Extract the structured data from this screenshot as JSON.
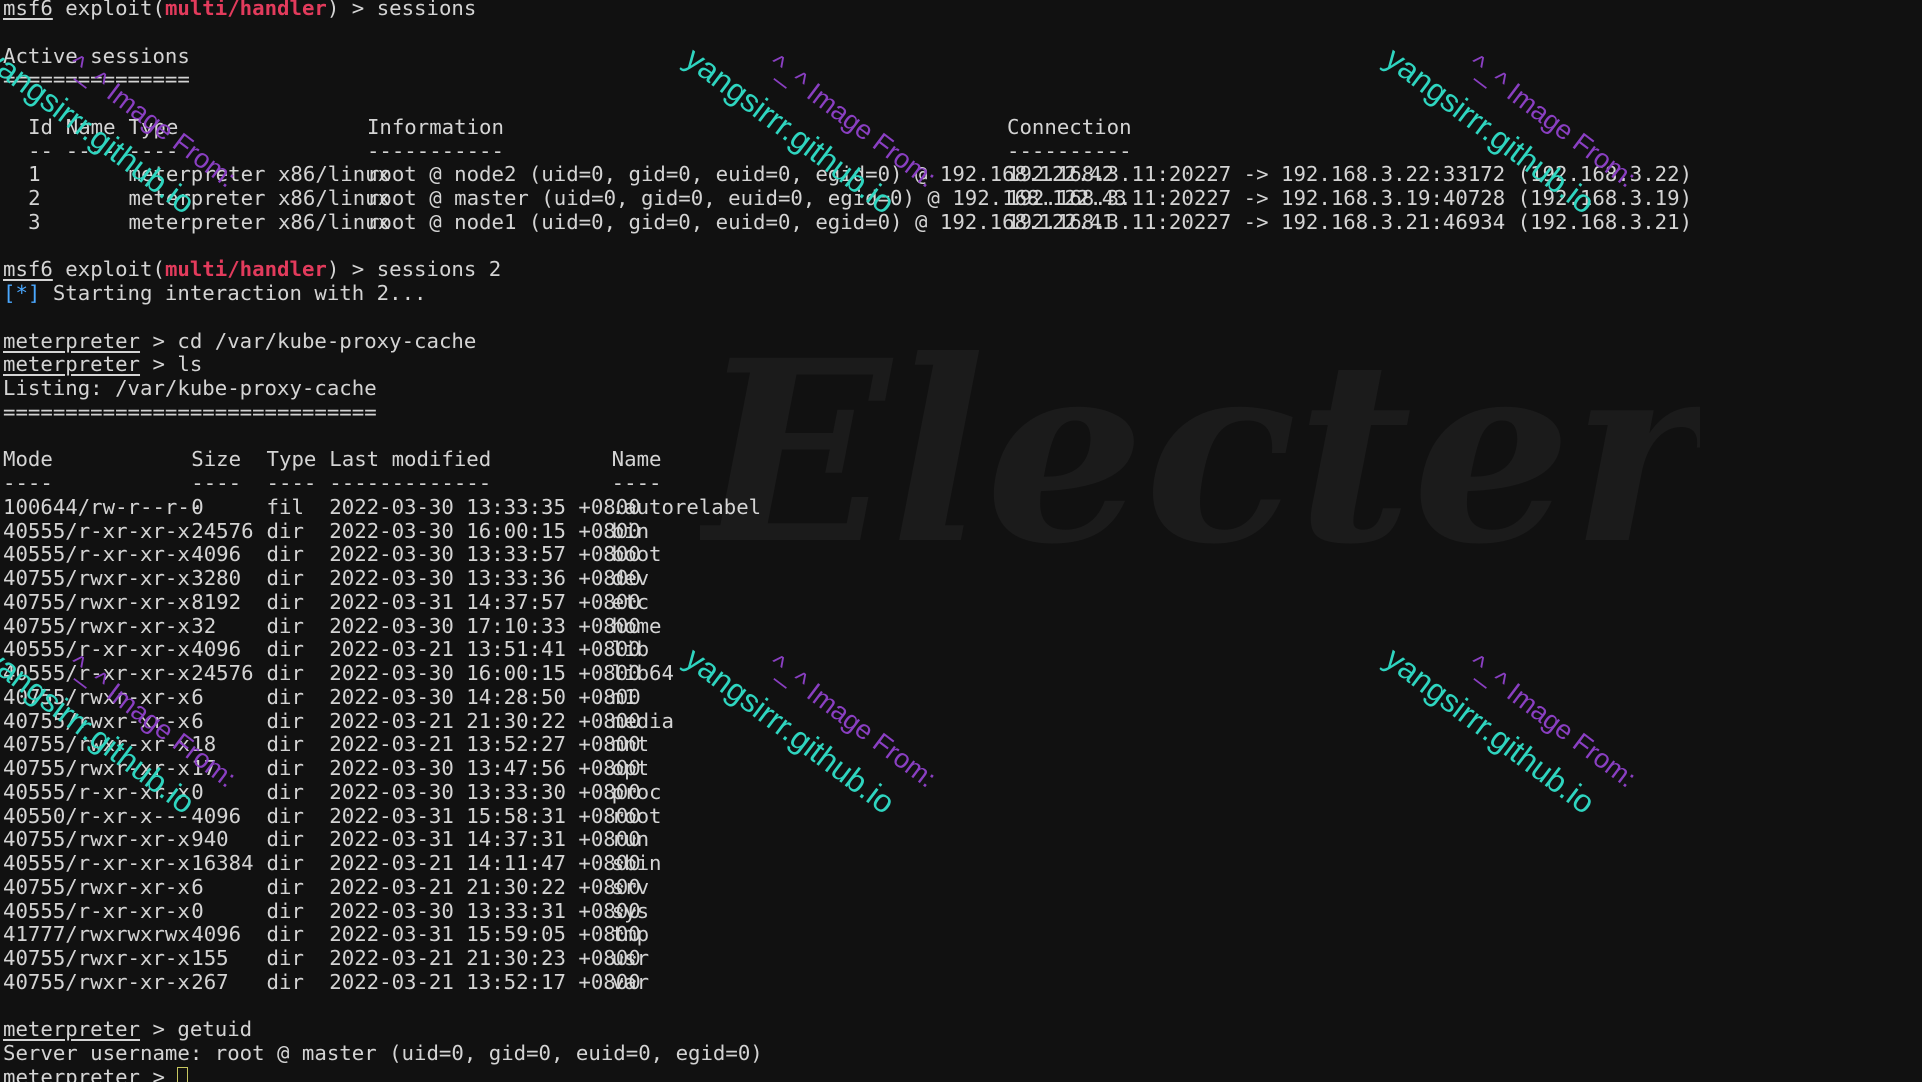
{
  "prompt_msf": "msf6",
  "prompt_exploit_prefix": " exploit(",
  "prompt_module": "multi/handler",
  "prompt_suffix": ") > ",
  "meterpreter_prompt": "meterpreter",
  "prompt_arrow": " > ",
  "cmd_sessions": "sessions",
  "sessions_title": "Active sessions",
  "sessions_title_rule": "===============",
  "sessions_headers": {
    "id": "Id",
    "name": "Name",
    "type": "Type",
    "information": "Information",
    "connection": "Connection"
  },
  "sessions_dashes": {
    "id": "--",
    "name": "----",
    "type": "----",
    "information": "-----------",
    "connection": "----------"
  },
  "sessions_rows": [
    {
      "id": "1",
      "type": "meterpreter x86/linux",
      "information": "root @ node2 (uid=0, gid=0, euid=0, egid=0) @ 192.168.122.42",
      "connection": "192.168.3.11:20227 -> 192.168.3.22:33172 (192.168.3.22)"
    },
    {
      "id": "2",
      "type": "meterpreter x86/linux",
      "information": "root @ master (uid=0, gid=0, euid=0, egid=0) @ 192.168.122.43",
      "connection": "192.168.3.11:20227 -> 192.168.3.19:40728 (192.168.3.19)"
    },
    {
      "id": "3",
      "type": "meterpreter x86/linux",
      "information": "root @ node1 (uid=0, gid=0, euid=0, egid=0) @ 192.168.122.41",
      "connection": "192.168.3.11:20227 -> 192.168.3.21:46934 (192.168.3.21)"
    }
  ],
  "cmd_sessions2": "sessions 2",
  "status_marker": "[*]",
  "status_text": " Starting interaction with 2...",
  "cmd_cd": "cd /var/kube-proxy-cache",
  "cmd_ls": "ls",
  "listing_title": "Listing: /var/kube-proxy-cache",
  "listing_rule": "==============================",
  "listing_headers": {
    "mode": "Mode",
    "size": "Size",
    "type": "Type",
    "modified": "Last modified",
    "name": "Name"
  },
  "listing_dashes": {
    "mode": "----",
    "size": "----",
    "type": "----",
    "modified": "-------------",
    "name": "----"
  },
  "files": [
    {
      "mode": "100644/rw-r--r--",
      "size": "0",
      "type": "fil",
      "modified": "2022-03-30 13:33:35 +0800",
      "name": ".autorelabel"
    },
    {
      "mode": "40555/r-xr-xr-x",
      "size": "24576",
      "type": "dir",
      "modified": "2022-03-30 16:00:15 +0800",
      "name": "bin"
    },
    {
      "mode": "40555/r-xr-xr-x",
      "size": "4096",
      "type": "dir",
      "modified": "2022-03-30 13:33:57 +0800",
      "name": "boot"
    },
    {
      "mode": "40755/rwxr-xr-x",
      "size": "3280",
      "type": "dir",
      "modified": "2022-03-30 13:33:36 +0800",
      "name": "dev"
    },
    {
      "mode": "40755/rwxr-xr-x",
      "size": "8192",
      "type": "dir",
      "modified": "2022-03-31 14:37:57 +0800",
      "name": "etc"
    },
    {
      "mode": "40755/rwxr-xr-x",
      "size": "32",
      "type": "dir",
      "modified": "2022-03-30 17:10:33 +0800",
      "name": "home"
    },
    {
      "mode": "40555/r-xr-xr-x",
      "size": "4096",
      "type": "dir",
      "modified": "2022-03-21 13:51:41 +0800",
      "name": "lib"
    },
    {
      "mode": "40555/r-xr-xr-x",
      "size": "24576",
      "type": "dir",
      "modified": "2022-03-30 16:00:15 +0800",
      "name": "lib64"
    },
    {
      "mode": "40755/rwxr-xr-x",
      "size": "6",
      "type": "dir",
      "modified": "2022-03-30 14:28:50 +0800",
      "name": "m1"
    },
    {
      "mode": "40755/rwxr-xr-x",
      "size": "6",
      "type": "dir",
      "modified": "2022-03-21 21:30:22 +0800",
      "name": "media"
    },
    {
      "mode": "40755/rwxr-xr-x",
      "size": "18",
      "type": "dir",
      "modified": "2022-03-21 13:52:27 +0800",
      "name": "mnt"
    },
    {
      "mode": "40755/rwxr-xr-x",
      "size": "17",
      "type": "dir",
      "modified": "2022-03-30 13:47:56 +0800",
      "name": "opt"
    },
    {
      "mode": "40555/r-xr-xr-x",
      "size": "0",
      "type": "dir",
      "modified": "2022-03-30 13:33:30 +0800",
      "name": "proc"
    },
    {
      "mode": "40550/r-xr-x---",
      "size": "4096",
      "type": "dir",
      "modified": "2022-03-31 15:58:31 +0800",
      "name": "root"
    },
    {
      "mode": "40755/rwxr-xr-x",
      "size": "940",
      "type": "dir",
      "modified": "2022-03-31 14:37:31 +0800",
      "name": "run"
    },
    {
      "mode": "40555/r-xr-xr-x",
      "size": "16384",
      "type": "dir",
      "modified": "2022-03-21 14:11:47 +0800",
      "name": "sbin"
    },
    {
      "mode": "40755/rwxr-xr-x",
      "size": "6",
      "type": "dir",
      "modified": "2022-03-21 21:30:22 +0800",
      "name": "srv"
    },
    {
      "mode": "40555/r-xr-xr-x",
      "size": "0",
      "type": "dir",
      "modified": "2022-03-30 13:33:31 +0800",
      "name": "sys"
    },
    {
      "mode": "41777/rwxrwxrwx",
      "size": "4096",
      "type": "dir",
      "modified": "2022-03-31 15:59:05 +0800",
      "name": "tmp"
    },
    {
      "mode": "40755/rwxr-xr-x",
      "size": "155",
      "type": "dir",
      "modified": "2022-03-21 21:30:23 +0800",
      "name": "usr"
    },
    {
      "mode": "40755/rwxr-xr-x",
      "size": "267",
      "type": "dir",
      "modified": "2022-03-21 13:52:17 +0800",
      "name": "var"
    }
  ],
  "cmd_getuid": "getuid",
  "getuid_output": "Server username: root @ master (uid=0, gid=0, euid=0, egid=0)",
  "watermark": {
    "logo_text": "Electerm",
    "site_text": "yangsirrr.github.io",
    "caption_text": "^_^ Image From:"
  },
  "colors": {
    "background": "#111111",
    "text": "#d4d4d4",
    "module_red": "#e23b5c",
    "status_blue": "#4aa8ff",
    "watermark_cyan": "#2fd5c0",
    "watermark_purple": "#8a3fc2"
  }
}
